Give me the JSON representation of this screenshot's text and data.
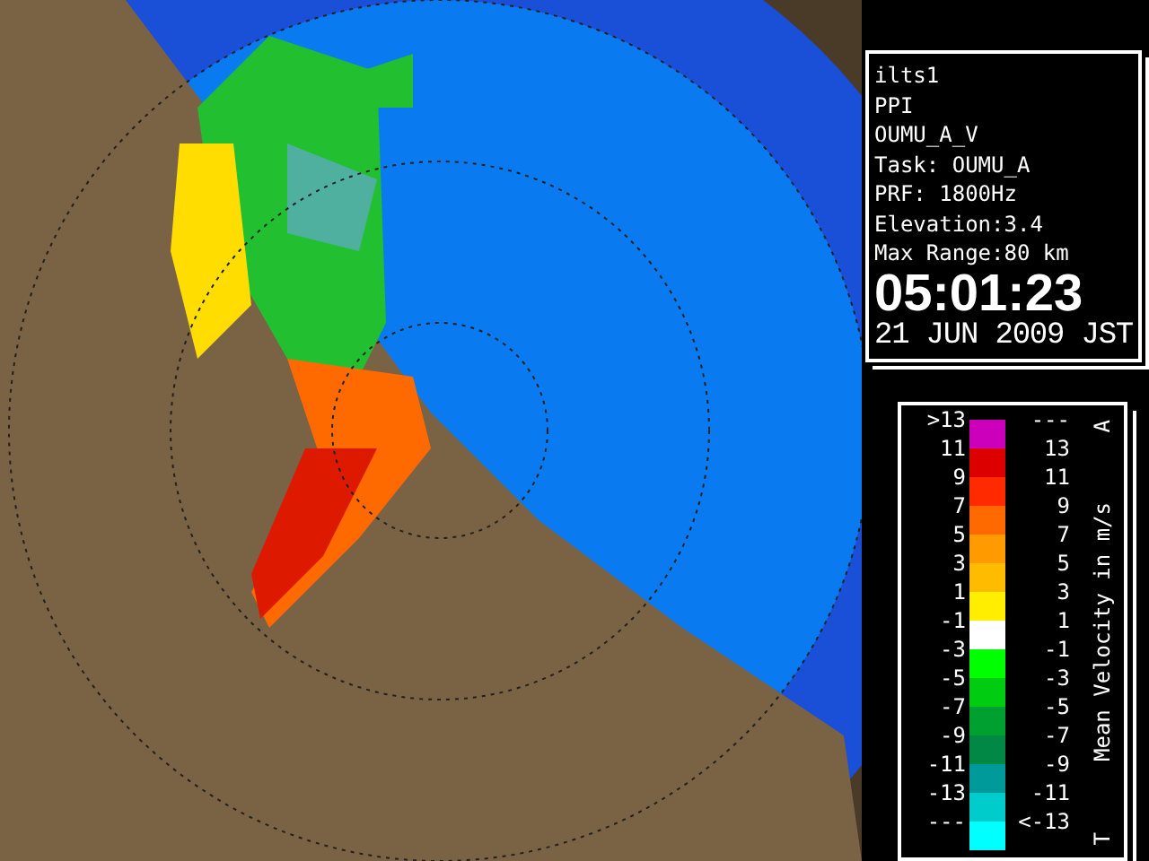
{
  "info": {
    "lines": [
      "ilts1",
      "PPI",
      "OUMU_A_V",
      "Task: OUMU_A",
      "PRF: 1800Hz",
      "Elevation:3.4",
      "Max Range:80 km"
    ],
    "time": "05:01:23",
    "date": "21 JUN 2009 JST"
  },
  "legend": {
    "title": "Mean Velocity in m/s",
    "top_mark": "A",
    "bottom_mark": "T",
    "rows": [
      {
        "low": ">13",
        "high": "---",
        "color": "#cc00bb"
      },
      {
        "low": "11",
        "high": "13",
        "color": "#dd0000"
      },
      {
        "low": "9",
        "high": "11",
        "color": "#ff2a00"
      },
      {
        "low": "7",
        "high": "9",
        "color": "#ff6a00"
      },
      {
        "low": "5",
        "high": "7",
        "color": "#ff9a00"
      },
      {
        "low": "3",
        "high": "5",
        "color": "#ffbb00"
      },
      {
        "low": "1",
        "high": "3",
        "color": "#ffee00"
      },
      {
        "low": "-1",
        "high": "1",
        "color": "#ffffff"
      },
      {
        "low": "-3",
        "high": "-1",
        "color": "#00ff00"
      },
      {
        "low": "-5",
        "high": "-3",
        "color": "#00cc11"
      },
      {
        "low": "-7",
        "high": "-5",
        "color": "#00a030"
      },
      {
        "low": "-9",
        "high": "-7",
        "color": "#008844"
      },
      {
        "low": "-11",
        "high": "-9",
        "color": "#009a9a"
      },
      {
        "low": "-13",
        "high": "-11",
        "color": "#00cccc"
      },
      {
        "low": "---",
        "high": "<-13",
        "color": "#00ffff"
      }
    ]
  }
}
